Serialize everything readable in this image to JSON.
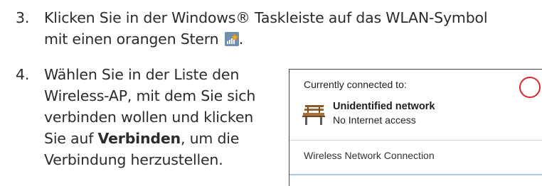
{
  "steps": [
    {
      "number": "3.",
      "lines": [
        "Klicken Sie in der Windows® Taskleiste auf das WLAN-Symbol",
        "mit einen orangen Stern"
      ],
      "icon": "wifi-star-icon",
      "trailing_punct": "."
    },
    {
      "number": "4.",
      "lines": [
        "Wählen Sie in der Liste den",
        "Wireless-AP, mit dem Sie sich",
        "verbinden wollen und klicken"
      ],
      "line4_pre": "Sie auf ",
      "line4_bold": "Verbinden",
      "line4_post": ", um die",
      "line5": "Verbindung herzustellen."
    }
  ],
  "popup": {
    "header": "Currently connected to:",
    "network_name": "Unidentified network",
    "network_status": "No Internet access",
    "section_label": "Wireless Network Connection",
    "icon": "bench-network-icon",
    "highlight_color": "#d9282d"
  },
  "colors": {
    "text": "#2b2b2b",
    "wifi_icon_bg": "#6f8faf",
    "star": "#f7a823"
  }
}
